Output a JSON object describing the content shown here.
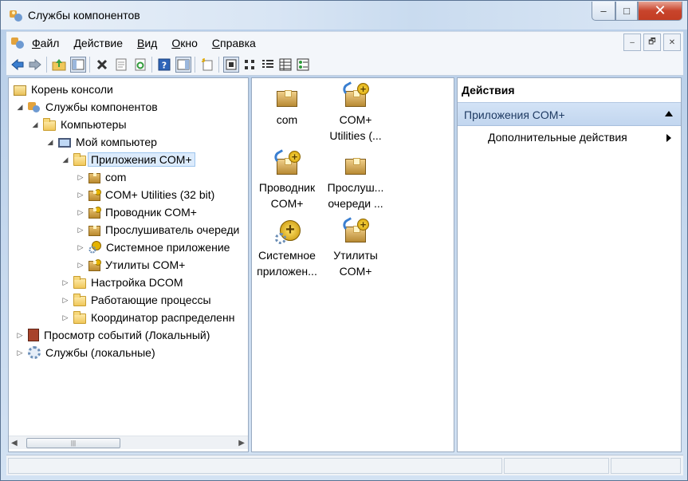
{
  "window": {
    "title": "Службы компонентов",
    "controls": {
      "minimize": "–",
      "maximize": "□",
      "close": "✕"
    }
  },
  "menubar": {
    "items": [
      {
        "label": "Файл",
        "hotkey_index": 0
      },
      {
        "label": "Действие",
        "hotkey_index": 0
      },
      {
        "label": "Вид",
        "hotkey_index": 0
      },
      {
        "label": "Окно",
        "hotkey_index": 0
      },
      {
        "label": "Справка",
        "hotkey_index": 0
      }
    ],
    "mdi_controls": {
      "minimize": "–",
      "restore": "🗗",
      "close": "✕"
    }
  },
  "toolbar": {
    "buttons": [
      "back-icon",
      "forward-icon",
      "up-folder-icon",
      "show-hide-tree-icon",
      "delete-icon",
      "properties-icon",
      "refresh-icon",
      "help-icon",
      "show-hide-action-pane-icon",
      "new-icon",
      "large-icons-view-icon",
      "small-icons-view-icon",
      "list-view-icon",
      "details-view-icon",
      "status-view-icon"
    ]
  },
  "tree": {
    "rows": [
      {
        "label": "Корень консоли",
        "icon": "console-root-icon",
        "expand": "",
        "indent": 0
      },
      {
        "label": "Службы компонентов",
        "icon": "component-services-icon",
        "expand": "expanded",
        "indent": 1
      },
      {
        "label": "Компьютеры",
        "icon": "folder-icon",
        "expand": "expanded",
        "indent": 2
      },
      {
        "label": "Мой компьютер",
        "icon": "computer-icon",
        "expand": "expanded",
        "indent": 3
      },
      {
        "label": "Приложения COM+",
        "icon": "folder-icon",
        "expand": "expanded",
        "indent": 4,
        "selected": true
      },
      {
        "label": "com",
        "icon": "com-app-icon",
        "expand": "collapsed",
        "indent": 5
      },
      {
        "label": "COM+ Utilities (32 bit)",
        "icon": "com-app-plus-icon",
        "expand": "collapsed",
        "indent": 5
      },
      {
        "label": "Проводник COM+",
        "icon": "com-app-plus-icon",
        "expand": "collapsed",
        "indent": 5
      },
      {
        "label": "Прослушиватель очереди",
        "icon": "com-app-icon",
        "expand": "collapsed",
        "indent": 5
      },
      {
        "label": "Системное приложение",
        "icon": "system-app-icon",
        "expand": "collapsed",
        "indent": 5
      },
      {
        "label": "Утилиты COM+",
        "icon": "com-app-plus-icon",
        "expand": "collapsed",
        "indent": 5
      },
      {
        "label": "Настройка DCOM",
        "icon": "folder-icon",
        "expand": "collapsed",
        "indent": 4
      },
      {
        "label": "Работающие процессы",
        "icon": "folder-icon",
        "expand": "collapsed",
        "indent": 4
      },
      {
        "label": "Координатор распределенн",
        "icon": "folder-icon",
        "expand": "collapsed",
        "indent": 4
      },
      {
        "label": "Просмотр событий (Локальный)",
        "icon": "event-viewer-icon",
        "expand": "collapsed",
        "indent": 1
      },
      {
        "label": "Службы (локальные)",
        "icon": "services-icon",
        "expand": "collapsed",
        "indent": 1
      }
    ],
    "scrollbar": {
      "left_arrow": "◀",
      "right_arrow": "▶",
      "thumb_grip": "|||"
    }
  },
  "content": {
    "items": [
      {
        "line1": "com",
        "line2": "",
        "icon": "com-app-icon"
      },
      {
        "line1": "COM+",
        "line2": "Utilities (...",
        "icon": "com-app-plus-icon"
      },
      {
        "line1": "Проводник",
        "line2": "COM+",
        "icon": "com-app-plus-icon"
      },
      {
        "line1": "Прослуш...",
        "line2": "очереди ...",
        "icon": "com-app-icon"
      },
      {
        "line1": "Системное",
        "line2": "приложен...",
        "icon": "system-app-icon"
      },
      {
        "line1": "Утилиты",
        "line2": "COM+",
        "icon": "com-app-plus-icon"
      }
    ]
  },
  "actions": {
    "header": "Действия",
    "group_title": "Приложения COM+",
    "items": [
      {
        "label": "Дополнительные действия",
        "has_submenu": true
      }
    ]
  }
}
